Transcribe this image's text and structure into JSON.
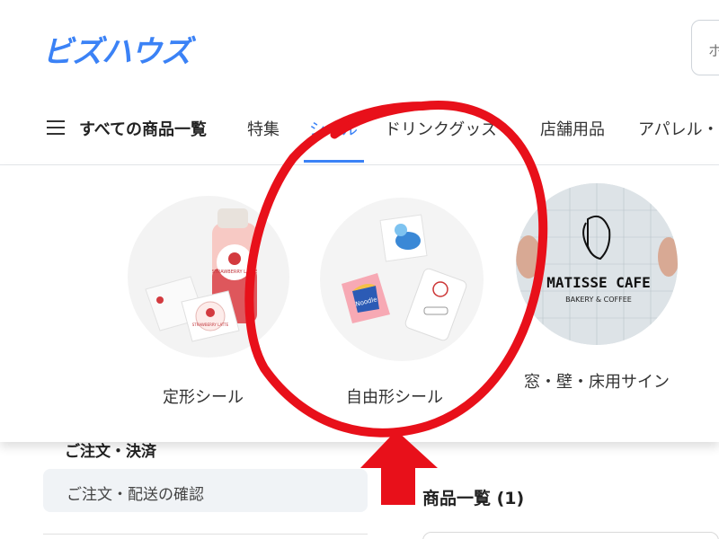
{
  "header": {
    "logo": "ビズハウズ",
    "search_placeholder_fragment": "ホ"
  },
  "nav": {
    "all_products": "すべての商品一覧",
    "items": [
      "特集",
      "シール",
      "ドリンクグッズ",
      "店舗用品",
      "アパレル・"
    ],
    "active": "シール"
  },
  "categories": [
    {
      "label": "定形シール"
    },
    {
      "label": "自由形シール"
    },
    {
      "label": "窓・壁・床用サイン"
    }
  ],
  "sidebar": {
    "section_heading": "ご注文・決済",
    "order_item": "ご注文・配送の確認"
  },
  "main": {
    "products_title": "商品一覧 (1)"
  },
  "images": {
    "sticker_text_1": "STRAWBERRY LATTE",
    "sticker_text_2": "STRAWBERRY LATTE",
    "sticker_text_3": "Noodle",
    "sign_line1": "MATISSE CAFE",
    "sign_line2": "BAKERY & COFFEE"
  },
  "colors": {
    "brand": "#3b82f6",
    "annotation": "#e8101a"
  }
}
